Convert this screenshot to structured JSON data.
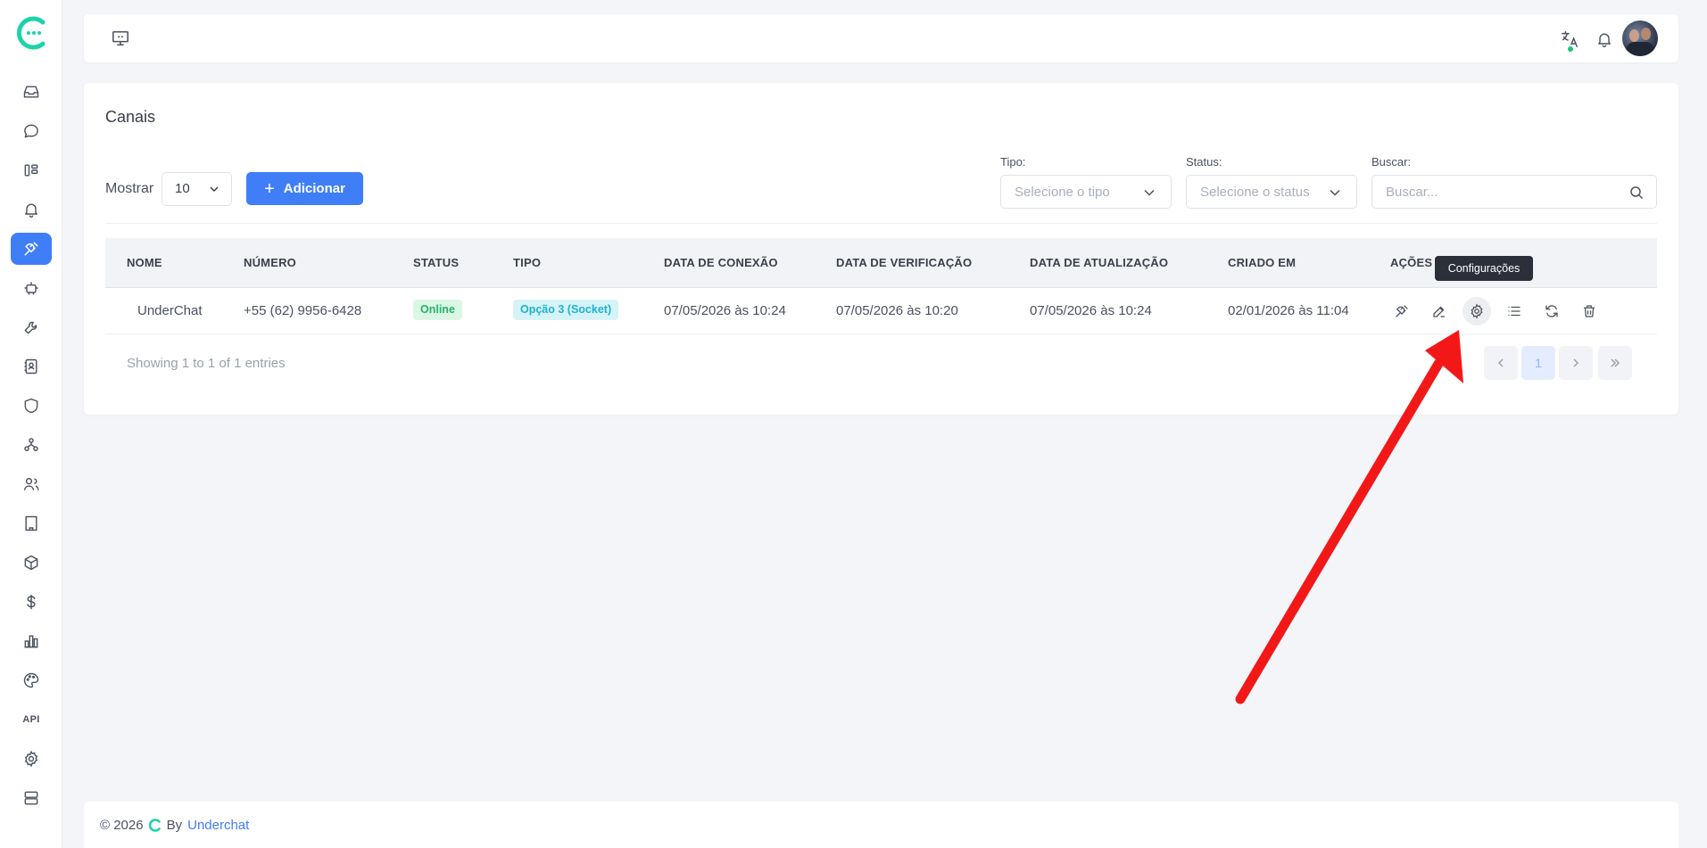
{
  "colors": {
    "accent": "#3f7ef6",
    "brand": "#1ed3a9",
    "online": "#24b36b",
    "type_badge": "#1db3cc"
  },
  "sidebar": {
    "items": [
      {
        "icon": "inbox-icon"
      },
      {
        "icon": "chat-icon"
      },
      {
        "icon": "kanban-icon"
      },
      {
        "icon": "bell-icon"
      },
      {
        "icon": "plug-icon",
        "active": true
      },
      {
        "icon": "robot-icon"
      },
      {
        "icon": "wrench-icon"
      },
      {
        "icon": "contacts-book-icon"
      },
      {
        "icon": "shield-icon"
      },
      {
        "icon": "hierarchy-icon"
      },
      {
        "icon": "users-icon"
      },
      {
        "icon": "building-icon"
      },
      {
        "icon": "box-icon"
      },
      {
        "icon": "dollar-icon"
      },
      {
        "icon": "bar-chart-icon"
      },
      {
        "icon": "palette-icon"
      },
      {
        "icon": "api-icon",
        "label": "API"
      },
      {
        "icon": "gear-icon"
      },
      {
        "icon": "server-icon"
      }
    ]
  },
  "page": {
    "title": "Canais",
    "show_label": "Mostrar",
    "show_value": "10",
    "add_button": "Adicionar",
    "filters": {
      "type_label": "Tipo:",
      "type_placeholder": "Selecione o tipo",
      "status_label": "Status:",
      "status_placeholder": "Selecione o status",
      "search_label": "Buscar:",
      "search_placeholder": "Buscar..."
    }
  },
  "table": {
    "columns": [
      "NOME",
      "NÚMERO",
      "STATUS",
      "TIPO",
      "DATA DE CONEXÃO",
      "DATA DE VERIFICAÇÃO",
      "DATA DE ATUALIZAÇÃO",
      "CRIADO EM",
      "AÇÕES"
    ],
    "rows": [
      {
        "name": "UnderChat",
        "number": "+55 (62) 9956-6428",
        "status": "Online",
        "type": "Opção 3 (Socket)",
        "connected_at": "07/05/2026 às 10:24",
        "verified_at": "07/05/2026 às 10:20",
        "updated_at": "07/05/2026 às 10:24",
        "created_at": "02/01/2026 às 11:04"
      }
    ],
    "actions": [
      "plug-icon",
      "edit-icon",
      "gear-icon",
      "list-icon",
      "refresh-icon",
      "trash-icon"
    ],
    "tooltip": "Configurações"
  },
  "pagination": {
    "info": "Showing 1 to 1 of 1 entries",
    "current_page": "1"
  },
  "footer": {
    "copyright": "© 2026",
    "by": "By",
    "link": "Underchat"
  }
}
